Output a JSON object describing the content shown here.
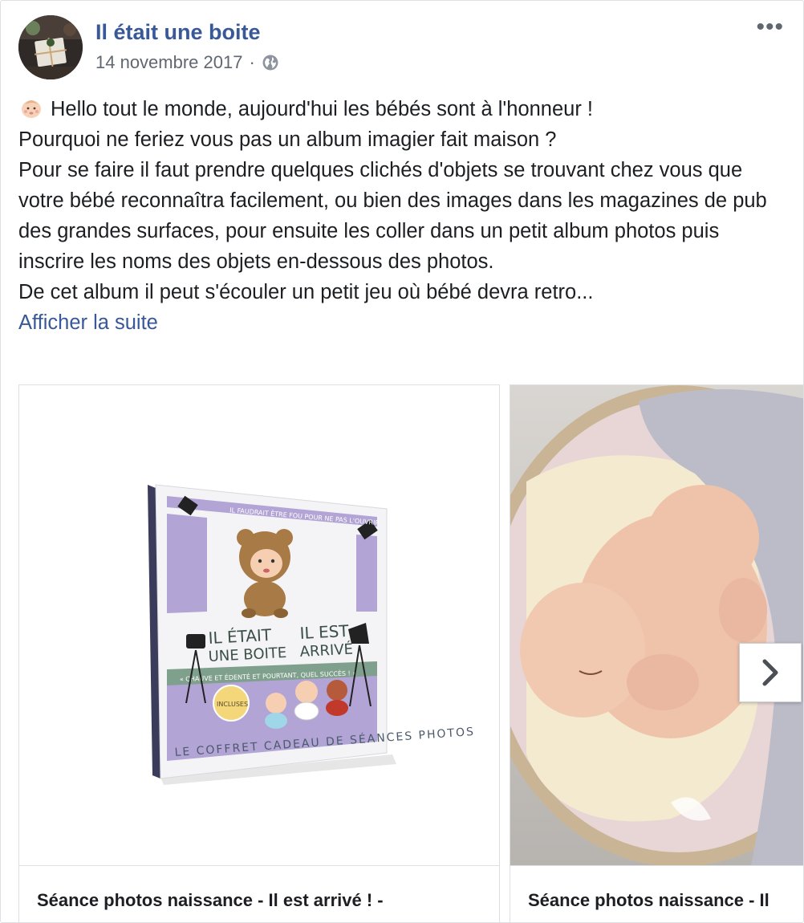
{
  "post": {
    "page_name": "Il était une boite",
    "date": "14 novembre 2017",
    "separator": "·",
    "privacy_icon": "globe-icon",
    "more_label": "•••",
    "text_lines": [
      "Hello tout le monde, aujourd'hui les bébés sont à l'honneur !",
      "Pourquoi ne feriez vous pas un album imagier fait maison ?",
      "Pour se faire il faut prendre quelques clichés d'objets se trouvant chez vous que votre bébé reconnaîtra facilement, ou bien des images dans les magazines de pub des grandes surfaces, pour ensuite les coller dans un petit album photos puis inscrire les noms des objets en-dessous des photos.",
      "De cet album il peut s'écouler un petit jeu où bébé devra retro..."
    ],
    "see_more": "Afficher la suite"
  },
  "carousel": {
    "items": [
      {
        "title": "Séance photos naissance - Il est arrivé ! -",
        "subtitle": "",
        "box_art": {
          "top_banner": "IL FAUDRAIT ÊTRE FOU POUR NE PAS L'OUVRIR",
          "title_left_1": "IL ÉTAIT",
          "title_left_2": "UNE BOITE",
          "title_right_1": "IL EST",
          "title_right_2": "ARRIVÉ",
          "tagline": "« CHAUVE ET ÉDENTÉ ET POURTANT, QUEL SUCCÈS ! »",
          "badge": "INCLUSES",
          "bottom": "LE COFFRET CADEAU DE SÉANCES PHOTOS"
        }
      },
      {
        "title": "Séance photos naissance - Il",
        "subtitle": ""
      }
    ],
    "next_icon": "chevron-right-icon"
  }
}
